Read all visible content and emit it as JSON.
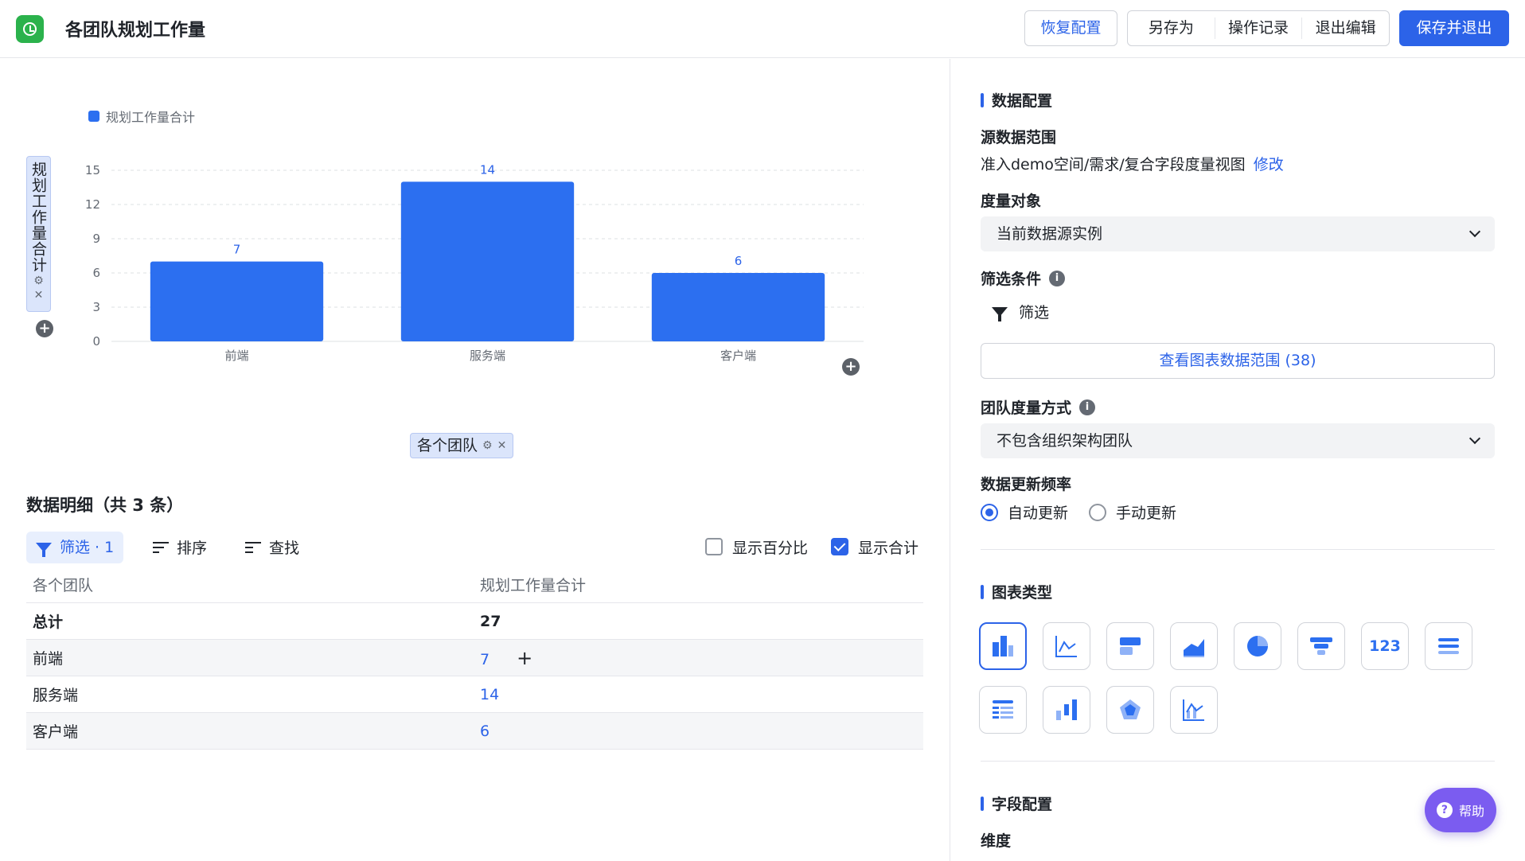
{
  "header": {
    "title": "各团队规划工作量",
    "restore_label": "恢复配置",
    "save_as_label": "另存为",
    "history_label": "操作记录",
    "exit_label": "退出编辑",
    "save_exit_label": "保存并退出"
  },
  "chart_data": {
    "type": "bar",
    "categories": [
      "前端",
      "服务端",
      "客户端"
    ],
    "series": [
      {
        "name": "规划工作量合计",
        "values": [
          7,
          14,
          6
        ]
      }
    ],
    "ylabel": "规划工作量合计",
    "xlabel": "各个团队",
    "ylim": [
      0,
      15
    ],
    "yticks": [
      0,
      3,
      6,
      9,
      12,
      15
    ],
    "grid": true,
    "legend": "top-left",
    "color": "#2c6ff0"
  },
  "detail": {
    "title": "数据明细（共 3 条）",
    "filter_label": "筛选 · 1",
    "sort_label": "排序",
    "find_label": "查找",
    "show_percent_label": "显示百分比",
    "show_total_label": "显示合计",
    "show_percent": false,
    "show_total": true,
    "columns": [
      "各个团队",
      "规划工作量合计"
    ],
    "total_label": "总计",
    "total_value": "27",
    "rows": [
      {
        "team": "前端",
        "value": "7"
      },
      {
        "team": "服务端",
        "value": "14"
      },
      {
        "team": "客户端",
        "value": "6"
      }
    ]
  },
  "config": {
    "data_section": "数据配置",
    "source_label": "源数据范围",
    "source_value": "准入demo空间/需求/复合字段度量视图",
    "source_edit": "修改",
    "measure_object_label": "度量对象",
    "measure_object_value": "当前数据源实例",
    "filter_cond_label": "筛选条件",
    "filter_label": "筛选",
    "view_range_label": "查看图表数据范围 (38)",
    "team_measure_label": "团队度量方式",
    "team_measure_value": "不包含组织架构团队",
    "update_freq_label": "数据更新频率",
    "auto_update": "自动更新",
    "manual_update": "手动更新",
    "chart_type_section": "图表类型",
    "chart_type_number": "123",
    "field_section": "字段配置",
    "dimension_label": "维度"
  },
  "help_label": "帮助"
}
